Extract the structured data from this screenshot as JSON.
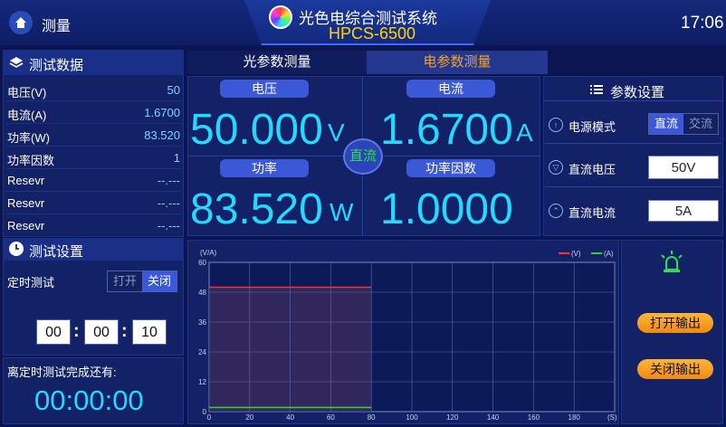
{
  "header": {
    "left_title": "测量",
    "title": "光色电综合测试系统",
    "model": "HPCS-6500",
    "time": "17:06"
  },
  "tabs": [
    {
      "label": "光参数测量"
    },
    {
      "label": "电参数测量"
    }
  ],
  "test_data": {
    "title": "测试数据",
    "rows": [
      {
        "label": "电压(V)",
        "value": "50"
      },
      {
        "label": "电流(A)",
        "value": "1.6700"
      },
      {
        "label": "功率(W)",
        "value": "83.520"
      },
      {
        "label": "功率因数",
        "value": "1"
      },
      {
        "label": "Resevr",
        "value": "--.---"
      },
      {
        "label": "Resevr",
        "value": "--.---"
      },
      {
        "label": "Resevr",
        "value": "--.---"
      }
    ]
  },
  "test_settings": {
    "title": "测试设置",
    "timer_label": "定时测试",
    "toggle_on": "打开",
    "toggle_off": "关闭",
    "h": "00",
    "m": "00",
    "s": "10",
    "sep": ":",
    "remaining_label": "离定时测试完成还有:",
    "remaining": "00:00:00"
  },
  "measure": {
    "voltage": {
      "label": "电压",
      "value": "50.000",
      "unit": "V"
    },
    "current": {
      "label": "电流",
      "value": "1.6700",
      "unit": "A"
    },
    "power": {
      "label": "功率",
      "value": "83.520",
      "unit": "W"
    },
    "pf": {
      "label": "功率因数",
      "value": "1.0000"
    },
    "mode_badge": "直流"
  },
  "params": {
    "title": "参数设置",
    "power_mode_label": "电源模式",
    "dc": "直流",
    "ac": "交流",
    "dc_voltage_label": "直流电压",
    "dc_voltage": "50V",
    "dc_current_label": "直流电流",
    "dc_current": "5A"
  },
  "output": {
    "open": "打开输出",
    "close": "关闭输出"
  },
  "chart_data": {
    "type": "line",
    "ylabel": "(V/A)",
    "xlabel": "(S)",
    "ylim": [
      0,
      60
    ],
    "xlim": [
      0,
      200
    ],
    "yticks": [
      "60",
      "48",
      "36",
      "24",
      "12",
      "0"
    ],
    "xticks": [
      "0",
      "20",
      "40",
      "60",
      "80",
      "100",
      "120",
      "140",
      "160",
      "180"
    ],
    "series": [
      {
        "name": "(V)",
        "color": "#ff3030",
        "x": [
          0,
          80
        ],
        "y": [
          50,
          50
        ]
      },
      {
        "name": "(A)",
        "color": "#30d030",
        "x": [
          0,
          80
        ],
        "y": [
          1.67,
          1.67
        ]
      }
    ],
    "legend": "top-right",
    "grid": true
  },
  "colors": {
    "accent": "#26d7ff",
    "orange": "#f7a326",
    "green": "#2be04a"
  }
}
